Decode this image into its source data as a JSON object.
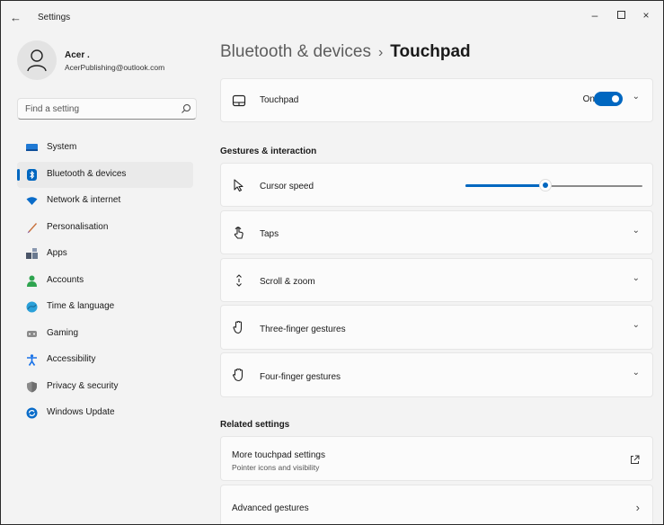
{
  "window": {
    "title": "Settings",
    "back_glyph": "←",
    "minimize_glyph": "–",
    "close_glyph": "×"
  },
  "profile": {
    "name": "Acer .",
    "email": "AcerPublishing@outlook.com"
  },
  "search": {
    "placeholder": "Find a setting"
  },
  "nav": {
    "items": [
      {
        "label": "System",
        "icon": "system-icon",
        "color": "#1f79d4"
      },
      {
        "label": "Bluetooth & devices",
        "icon": "bluetooth-icon",
        "color": "#0067c0",
        "active": true
      },
      {
        "label": "Network & internet",
        "icon": "wifi-icon",
        "color": "#0a6cc9"
      },
      {
        "label": "Personalisation",
        "icon": "brush-icon",
        "color": "#c7703a"
      },
      {
        "label": "Apps",
        "icon": "apps-icon",
        "color": "#4a5568"
      },
      {
        "label": "Accounts",
        "icon": "accounts-icon",
        "color": "#2ea44f"
      },
      {
        "label": "Time & language",
        "icon": "globe-clock-icon",
        "color": "#2aa0d9"
      },
      {
        "label": "Gaming",
        "icon": "gamepad-icon",
        "color": "#8a8a8a"
      },
      {
        "label": "Accessibility",
        "icon": "accessibility-icon",
        "color": "#1a73e8"
      },
      {
        "label": "Privacy & security",
        "icon": "shield-icon",
        "color": "#8a8a8a"
      },
      {
        "label": "Windows Update",
        "icon": "update-icon",
        "color": "#0a6cc9"
      }
    ]
  },
  "header": {
    "breadcrumb_parent": "Bluetooth & devices",
    "separator": "›",
    "current": "Touchpad"
  },
  "touchpad_card": {
    "label": "Touchpad",
    "toggle_text": "On",
    "toggle_on": true
  },
  "gestures": {
    "section_title": "Gestures & interaction",
    "cursor_speed": {
      "label": "Cursor speed",
      "value_fraction": 0.45
    },
    "items": [
      {
        "label": "Taps",
        "icon": "tap-icon"
      },
      {
        "label": "Scroll & zoom",
        "icon": "scroll-icon"
      },
      {
        "label": "Three-finger gestures",
        "icon": "three-finger-icon"
      },
      {
        "label": "Four-finger gestures",
        "icon": "four-finger-icon"
      }
    ]
  },
  "related": {
    "section_title": "Related settings",
    "more_touchpad": {
      "label": "More touchpad settings",
      "sub": "Pointer icons and visibility"
    },
    "advanced": {
      "label": "Advanced gestures"
    }
  },
  "glyphs": {
    "chevron_down": "⌄",
    "chevron_right": "›"
  },
  "colors": {
    "accent": "#0067c0",
    "background": "#f3f3f3",
    "card": "#fbfbfb"
  }
}
